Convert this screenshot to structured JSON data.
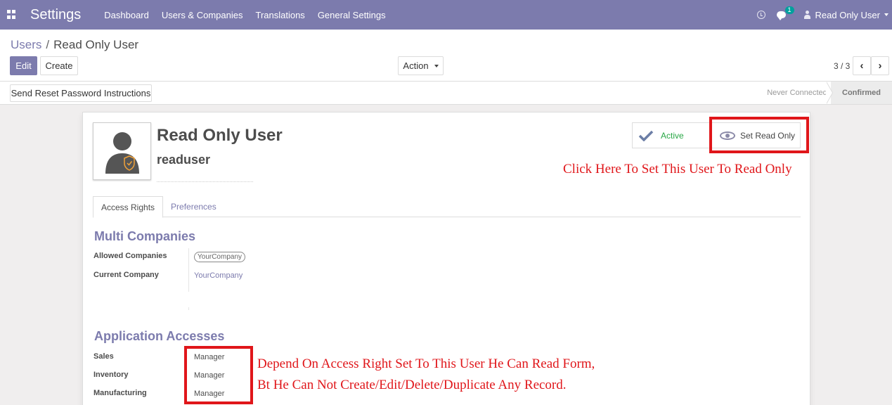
{
  "navbar": {
    "brand": "Settings",
    "menu": [
      "Dashboard",
      "Users & Companies",
      "Translations",
      "General Settings"
    ],
    "chat_count": "1",
    "user": "Read Only User"
  },
  "breadcrumb": {
    "parent": "Users",
    "separator": "/",
    "current": "Read Only User"
  },
  "buttons": {
    "edit": "Edit",
    "create": "Create",
    "action": "Action",
    "reset_password": "Send Reset Password Instructions"
  },
  "pager": {
    "value": "3 / 3"
  },
  "status": {
    "stages": [
      "Never Connected",
      "Confirmed"
    ],
    "current": "Confirmed"
  },
  "user": {
    "name": "Read Only User",
    "login": "readuser"
  },
  "smart_buttons": {
    "active": "Active",
    "read_only": "Set Read Only"
  },
  "tabs": [
    "Access Rights",
    "Preferences"
  ],
  "multi_companies": {
    "title": "Multi Companies",
    "allowed_label": "Allowed Companies",
    "allowed_value": "YourCompany",
    "current_label": "Current Company",
    "current_value": "YourCompany"
  },
  "application_accesses": {
    "title": "Application Accesses",
    "rows": [
      {
        "label": "Sales",
        "value": "Manager"
      },
      {
        "label": "Inventory",
        "value": "Manager"
      },
      {
        "label": "Manufacturing",
        "value": "Manager"
      }
    ]
  },
  "annotations": {
    "read_only": "Click Here To Set This User To Read Only",
    "access_line1": "Depend On Access Right Set To This User He Can Read Form,",
    "access_line2": "Bt He Can Not Create/Edit/Delete/Duplicate Any Record."
  },
  "colors": {
    "brand": "#7c7bad",
    "annotation": "#e0161a",
    "active": "#28a745"
  }
}
